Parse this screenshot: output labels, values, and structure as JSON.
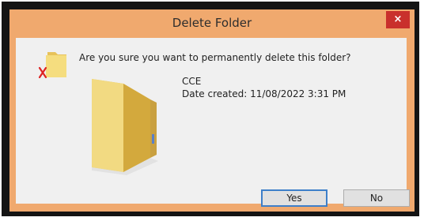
{
  "dialog": {
    "title": "Delete Folder",
    "close_glyph": "×",
    "message": "Are you sure you want to permanently delete this folder?",
    "folder_name": "CCE",
    "date_created": "Date created: 11/08/2022 3:31 PM",
    "buttons": {
      "yes": "Yes",
      "no": "No"
    }
  },
  "icons": [
    "folder-delete-icon",
    "folder-icon",
    "close-icon"
  ],
  "colors": {
    "titlebar": "#f0a96e",
    "close": "#c9302c",
    "focus": "#3d7fc9"
  }
}
